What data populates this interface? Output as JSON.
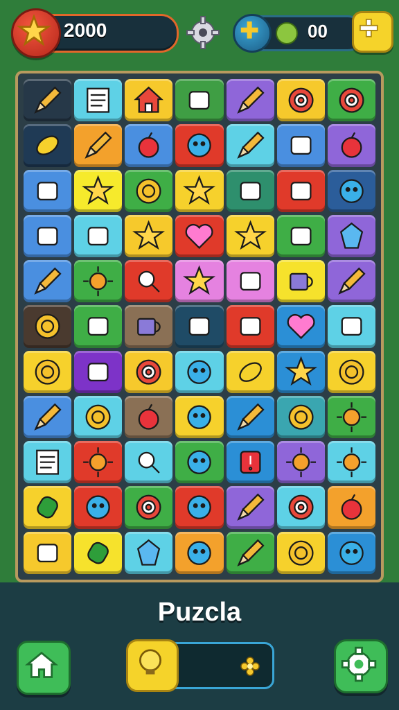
{
  "hud": {
    "score": "2000",
    "coins": "00",
    "colors": {
      "score_ring": "#e2672a",
      "coin_ring": "#2a6d86",
      "add": "#f5d32a"
    }
  },
  "title": "Puzcla",
  "board": {
    "rows": 11,
    "cols": 7,
    "tiles": [
      {
        "icon": "pencil-icon",
        "color": "#263848"
      },
      {
        "icon": "document-icon",
        "color": "#5ed1e6"
      },
      {
        "icon": "house-icon",
        "color": "#f6c92c"
      },
      {
        "icon": "gift-icon",
        "color": "#3f9e44"
      },
      {
        "icon": "pencil-icon",
        "color": "#8f66d9"
      },
      {
        "icon": "compass-icon",
        "color": "#f6c92c"
      },
      {
        "icon": "target-icon",
        "color": "#3fae46"
      },
      {
        "icon": "leaf-icon",
        "color": "#1f3a55"
      },
      {
        "icon": "pencil-icon",
        "color": "#f3a12c"
      },
      {
        "icon": "berry-icon",
        "color": "#4a8fe0"
      },
      {
        "icon": "globe-icon",
        "color": "#e03a2a"
      },
      {
        "icon": "pencil-icon",
        "color": "#5ed1e6"
      },
      {
        "icon": "potion-icon",
        "color": "#4a8fe0"
      },
      {
        "icon": "apple-icon",
        "color": "#8f66d9"
      },
      {
        "icon": "pin-icon",
        "color": "#4a8fe0"
      },
      {
        "icon": "star-icon",
        "color": "#f6ea2c"
      },
      {
        "icon": "ring-icon",
        "color": "#3fae46"
      },
      {
        "icon": "star-icon",
        "color": "#f6d12c"
      },
      {
        "icon": "box-icon",
        "color": "#2e8f6d"
      },
      {
        "icon": "folder-icon",
        "color": "#e03a2a"
      },
      {
        "icon": "face-icon",
        "color": "#2b5d9a"
      },
      {
        "icon": "pin-icon",
        "color": "#4a8fe0"
      },
      {
        "icon": "cap-icon",
        "color": "#5ed1e6"
      },
      {
        "icon": "star-icon",
        "color": "#f6c92c"
      },
      {
        "icon": "heart-icon",
        "color": "#e03a2a"
      },
      {
        "icon": "star-icon",
        "color": "#f6d12c"
      },
      {
        "icon": "card-icon",
        "color": "#3fae46"
      },
      {
        "icon": "gem-icon",
        "color": "#8f66d9"
      },
      {
        "icon": "pencil-icon",
        "color": "#4a8fe0"
      },
      {
        "icon": "sun-icon",
        "color": "#3fae46"
      },
      {
        "icon": "search-icon",
        "color": "#e03a2a"
      },
      {
        "icon": "star-icon",
        "color": "#e582e0"
      },
      {
        "icon": "puzzle-icon",
        "color": "#e582e0"
      },
      {
        "icon": "mug-icon",
        "color": "#f6e22c"
      },
      {
        "icon": "pencil-icon",
        "color": "#8f66d9"
      },
      {
        "icon": "ring-icon",
        "color": "#4a3a2f"
      },
      {
        "icon": "crown-icon",
        "color": "#3fae46"
      },
      {
        "icon": "mug-icon",
        "color": "#8a7055"
      },
      {
        "icon": "thumb-icon",
        "color": "#1f4b66"
      },
      {
        "icon": "tag-icon",
        "color": "#e03a2a"
      },
      {
        "icon": "heart-icon",
        "color": "#2b8fd6"
      },
      {
        "icon": "robot-icon",
        "color": "#5ed1e6"
      },
      {
        "icon": "coin-icon",
        "color": "#f6d12c"
      },
      {
        "icon": "brush-icon",
        "color": "#7d33c8"
      },
      {
        "icon": "target-icon",
        "color": "#f6c92c"
      },
      {
        "icon": "bubble-icon",
        "color": "#5ed1e6"
      },
      {
        "icon": "leaf-icon",
        "color": "#f6d12c"
      },
      {
        "icon": "star-icon",
        "color": "#2b8fd6"
      },
      {
        "icon": "coin-icon",
        "color": "#f6d12c"
      },
      {
        "icon": "pencil-icon",
        "color": "#4a8fe0"
      },
      {
        "icon": "ring-icon",
        "color": "#5ed1e6"
      },
      {
        "icon": "berry-icon",
        "color": "#8a7055"
      },
      {
        "icon": "bubble-icon",
        "color": "#f6d12c"
      },
      {
        "icon": "pencil-icon",
        "color": "#2b8fd6"
      },
      {
        "icon": "coin-icon",
        "color": "#3aa6b0"
      },
      {
        "icon": "splat-icon",
        "color": "#3fae46"
      },
      {
        "icon": "chart-icon",
        "color": "#5ed1e6"
      },
      {
        "icon": "sun-icon",
        "color": "#e03a2a"
      },
      {
        "icon": "search-icon",
        "color": "#5ed1e6"
      },
      {
        "icon": "bubble-icon",
        "color": "#3fae46"
      },
      {
        "icon": "alert-icon",
        "color": "#2b8fd6"
      },
      {
        "icon": "flower-icon",
        "color": "#8f66d9"
      },
      {
        "icon": "splat-icon",
        "color": "#5ed1e6"
      },
      {
        "icon": "capsule-icon",
        "color": "#f6d12c"
      },
      {
        "icon": "face-icon",
        "color": "#e03a2a"
      },
      {
        "icon": "target-icon",
        "color": "#3fae46"
      },
      {
        "icon": "blob-icon",
        "color": "#e03a2a"
      },
      {
        "icon": "pencil-icon",
        "color": "#8f66d9"
      },
      {
        "icon": "compass-icon",
        "color": "#5ed1e6"
      },
      {
        "icon": "apple-icon",
        "color": "#f3a12c"
      },
      {
        "icon": "burger-icon",
        "color": "#f6c92c"
      },
      {
        "icon": "can-icon",
        "color": "#f6e22c"
      },
      {
        "icon": "crystal-icon",
        "color": "#5ed1e6"
      },
      {
        "icon": "planet-icon",
        "color": "#f3a12c"
      },
      {
        "icon": "pencil-icon",
        "color": "#3fae46"
      },
      {
        "icon": "lemon-icon",
        "color": "#f6d12c"
      },
      {
        "icon": "planet-icon",
        "color": "#2b8fd6"
      }
    ]
  },
  "footer": {
    "home_icon": "home-icon",
    "hint_icon": "lightbulb-icon",
    "hint_badge_icon": "sparkle-icon",
    "settings_icon": "gear-icon"
  }
}
